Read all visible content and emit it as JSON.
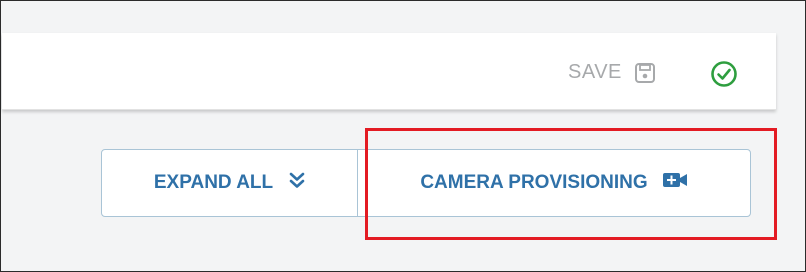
{
  "toolbar": {
    "save_label": "SAVE",
    "save_icon": "floppy-disk-icon",
    "status_icon": "check-circle-icon"
  },
  "actions": {
    "expand_label": "EXPAND ALL",
    "expand_icon": "double-chevron-down-icon",
    "camera_label": "CAMERA PROVISIONING",
    "camera_icon": "video-camera-plus-icon"
  },
  "colors": {
    "accent": "#2f71a8",
    "save_disabled": "#a7a9ab",
    "success": "#2e9e3f",
    "highlight": "#e31b23",
    "button_border": "#a9c4d6"
  }
}
